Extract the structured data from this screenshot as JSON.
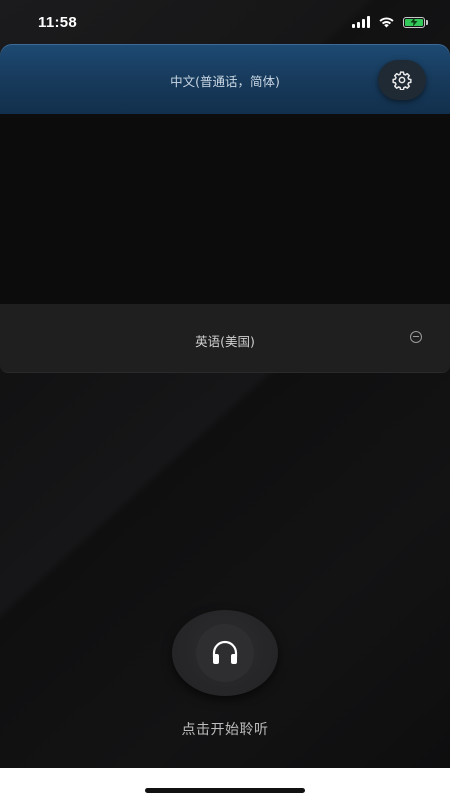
{
  "status_bar": {
    "time": "11:58"
  },
  "source": {
    "language": "中文(普通话，简体)",
    "settings_icon": "gear-icon"
  },
  "target": {
    "language": "英语(美国)",
    "collapse_icon": "minus-circle-icon"
  },
  "listen": {
    "icon": "headphones-icon",
    "label": "点击开始聆听"
  },
  "colors": {
    "accent_blue": "#1d4a73",
    "background": "#141414",
    "battery_green": "#34c759"
  }
}
